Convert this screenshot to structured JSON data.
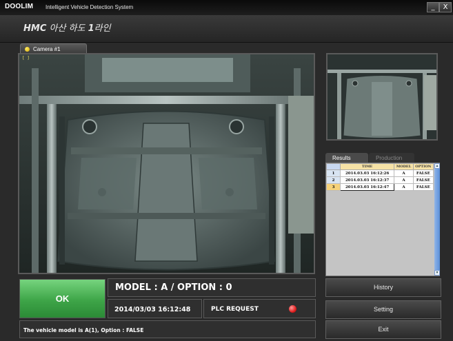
{
  "titlebar": {
    "brand": "DOOLIM",
    "subtitle": "Intelligent Vehicle Detection System",
    "minimize_glyph": "_",
    "close_glyph": "X"
  },
  "header": {
    "line_prefix": "HMC",
    "line_name": "아산 하도",
    "line_num": "1",
    "line_suffix": "라인"
  },
  "camera": {
    "tab_label": "Camera #1",
    "overlay_text": "[ ]"
  },
  "results": {
    "tab_active": "Results",
    "tab_inactive": "Production",
    "columns": [
      "TIME",
      "MODEL",
      "OPTION"
    ],
    "rows": [
      {
        "num": "1",
        "time": "2014.03.03 16:12:26",
        "model": "A",
        "option": "FALSE"
      },
      {
        "num": "2",
        "time": "2014.03.03 16:12:37",
        "model": "A",
        "option": "FALSE"
      },
      {
        "num": "3",
        "time": "2014.03.03 16:12:47",
        "model": "A",
        "option": "FALSE"
      }
    ],
    "scroll_up_glyph": "▲",
    "scroll_down_glyph": "▼"
  },
  "status": {
    "ok_label": "OK",
    "model_text": "MODEL : A / OPTION : 0",
    "datetime": "2014/03/03  16:12:48",
    "plc_label": "PLC REQUEST",
    "message": "The vehicle model is A(1), Option : FALSE"
  },
  "actions": {
    "history": "History",
    "setting": "Setting",
    "exit": "Exit"
  },
  "colors": {
    "ok_green": "#3ea548",
    "plc_led_red": "#e02020",
    "tab_dot_yellow": "#f2c800",
    "table_header": "#f6e2a6"
  }
}
